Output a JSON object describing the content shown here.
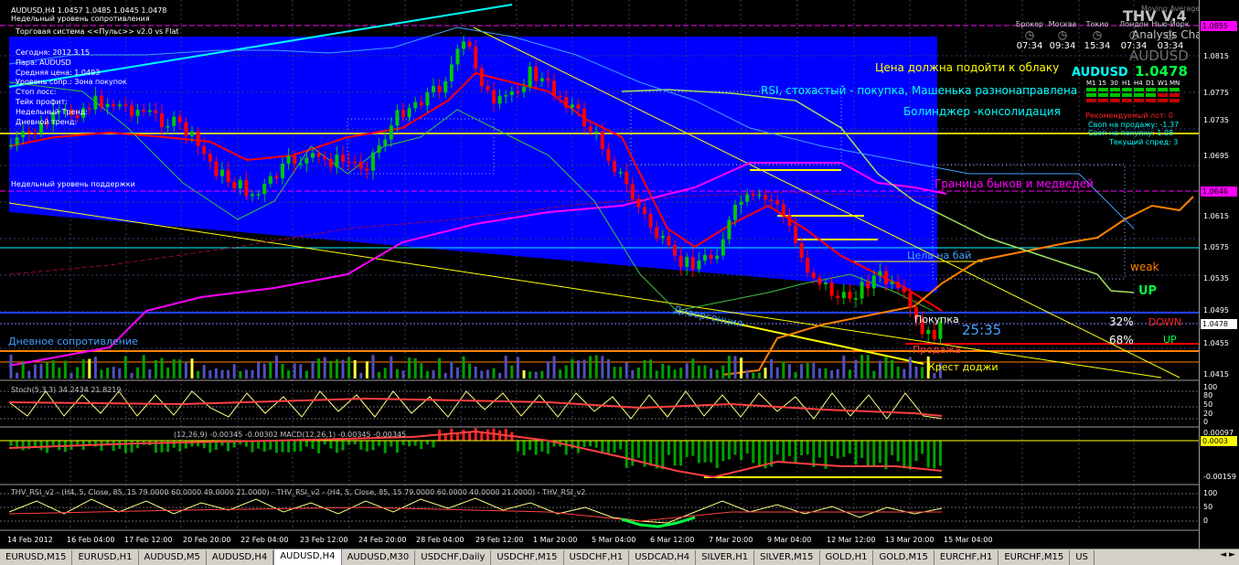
{
  "window": {
    "title": "AUDUSD,H4  1.0457 1.0485 1.0445 1.0478",
    "close_label": "x"
  },
  "chart_labels": {
    "weekly_resistance": "Недельный уровень сопротивления",
    "trading_system": "Торговая система <<Пульс>> v2.0 vs Flat",
    "weekly_support": "Недельный уровень поддержки",
    "daily_resistance": "Дневное сопротивление",
    "divergence": "Дивергенция",
    "buy_target": "Цель на бай",
    "bull_bear_border": "Граница быков и медведей",
    "buy": "Покупка",
    "sell": "Продажа",
    "doji_cross": "Крест доджи",
    "countdown": "25:35",
    "pct_down": "32%",
    "down_label": "DOWN",
    "pct_up": "68%",
    "up_label": "UP",
    "weak": "weak",
    "up_big": "UP"
  },
  "info_block": [
    "Сегодня:  2012.3.15",
    "Пара:  AUDUSD",
    "Средняя цена: 1.0493",
    "Уровень сопр.: Зона покупок",
    "Стоп лосс:",
    "Тейк профит:",
    "Недельный Тренд:",
    "Дневной тренд:"
  ],
  "comments": [
    "Цена должна подойти к облаку",
    "RSI, стохастый - покупка,  Машенька разнонаправлена",
    "Болинджер -консолидация"
  ],
  "panel": {
    "brand": "THV V.4",
    "ma_label": "Moving Average",
    "analysis": "Analysis Chart",
    "symbol_ghost": "AUDUSD",
    "symbol": "AUDUSD",
    "price": "1.0478",
    "timeframes": [
      "M1",
      "15",
      "30",
      "H1",
      "H4",
      "D1",
      "W1",
      "MN"
    ],
    "lot": "Рекомендуемый лот: 0",
    "swap_sell": "Своп на продажу: -1.37",
    "swap_buy": "Своп на покупку: 1.08",
    "spread": "Текущий спред: 3"
  },
  "clocks": [
    {
      "name": "Брокер",
      "time": "07:34",
      "icon": "clock-icon"
    },
    {
      "name": "Москва",
      "time": "09:34",
      "icon": "clock-icon"
    },
    {
      "name": "Токио",
      "time": "15:34",
      "icon": "clock-icon"
    },
    {
      "name": "Лондон",
      "time": "07:34",
      "icon": "clock-icon"
    },
    {
      "name": "Нью-Йорк",
      "time": "03:34",
      "icon": "clock-icon"
    }
  ],
  "price_axis": [
    "1.0855",
    "1.0815",
    "1.0775",
    "1.0735",
    "1.0695",
    "1.0646",
    "1.0615",
    "1.0575",
    "1.0535",
    "1.0495",
    "1.0478",
    "1.0455",
    "1.0415"
  ],
  "indicators": {
    "stoch": "Stoch(5,3,3) 34.2434 21.8219",
    "stoch_levels": [
      "100",
      "80",
      "50",
      "20",
      "0"
    ],
    "macd": "(12,26,9) -0.00345 -0.00302  MACD(12,26,1) -0.00345 -0.00345",
    "macd_levels": [
      "0.00097",
      "0.0003",
      "-0.00159"
    ],
    "rsi": "THV_RSI_v2 - (H4, 5, Close, 85, 15 79.0000 60.0000 49.0000 21.0000) - THV_RSI_v2 - (H4, 5, Close, 85, 15 79.0000 60.0000 40.0000 21.0000) - THV_RSI_v2",
    "rsi_levels": [
      "100",
      "50",
      "0"
    ]
  },
  "time_axis": [
    "14 Feb 2012",
    "16 Feb 04:00",
    "17 Feb 12:00",
    "20 Feb 20:00",
    "22 Feb 04:00",
    "23 Feb 12:00",
    "24 Feb 20:00",
    "28 Feb 04:00",
    "29 Feb 12:00",
    "1 Mar 20:00",
    "5 Mar 04:00",
    "6 Mar 12:00",
    "7 Mar 20:00",
    "9 Mar 04:00",
    "12 Mar 12:00",
    "13 Mar 20:00",
    "15 Mar 04:00"
  ],
  "tabs": [
    {
      "label": "EURUSD,M15",
      "active": false
    },
    {
      "label": "EURUSD,H1",
      "active": false
    },
    {
      "label": "AUDUSD,M5",
      "active": false
    },
    {
      "label": "AUDUSD,H4",
      "active": false
    },
    {
      "label": "AUDUSD,H4",
      "active": true
    },
    {
      "label": "AUDUSD,M30",
      "active": false
    },
    {
      "label": "USDCHF,Daily",
      "active": false
    },
    {
      "label": "USDCHF,M15",
      "active": false
    },
    {
      "label": "USDCHF,H1",
      "active": false
    },
    {
      "label": "USDCAD,H4",
      "active": false
    },
    {
      "label": "SILVER,H1",
      "active": false
    },
    {
      "label": "SILVER,M15",
      "active": false
    },
    {
      "label": "GOLD,H1",
      "active": false
    },
    {
      "label": "GOLD,M15",
      "active": false
    },
    {
      "label": "EURCHF,H1",
      "active": false
    },
    {
      "label": "EURCHF,M15",
      "active": false
    },
    {
      "label": "US",
      "active": false
    }
  ],
  "tab_nav": "◄ ►",
  "colors": {
    "blue_zone": "#0000ff",
    "bull": "#00c800",
    "bear": "#ff0000",
    "magenta": "#ff00ff",
    "yellow": "#ffff00",
    "cyan": "#00ffff",
    "orange": "#ff8000"
  }
}
